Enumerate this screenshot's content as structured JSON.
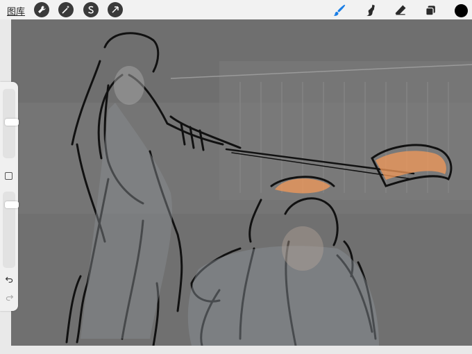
{
  "toolbar": {
    "gallery_label": "图库",
    "left_tools": [
      {
        "icon": "wrench-icon",
        "name": "actions"
      },
      {
        "icon": "magic-wand-icon",
        "name": "adjustments"
      },
      {
        "icon": "selection-s-icon",
        "name": "selection"
      },
      {
        "icon": "arrow-cursor-icon",
        "name": "transform"
      }
    ],
    "right_tools": [
      {
        "icon": "brush-icon",
        "name": "paint",
        "active": true
      },
      {
        "icon": "smudge-icon",
        "name": "smudge"
      },
      {
        "icon": "eraser-icon",
        "name": "erase"
      },
      {
        "icon": "layers-icon",
        "name": "layers"
      },
      {
        "icon": "color-swatch-icon",
        "name": "color"
      }
    ],
    "active_color": "#000000",
    "accent_color": "#1a7ee6"
  },
  "sidebar": {
    "brush_size_level": 0.52,
    "opacity_level": 0.86
  },
  "canvas": {
    "background_color": "#767676",
    "description_hidden": true
  }
}
